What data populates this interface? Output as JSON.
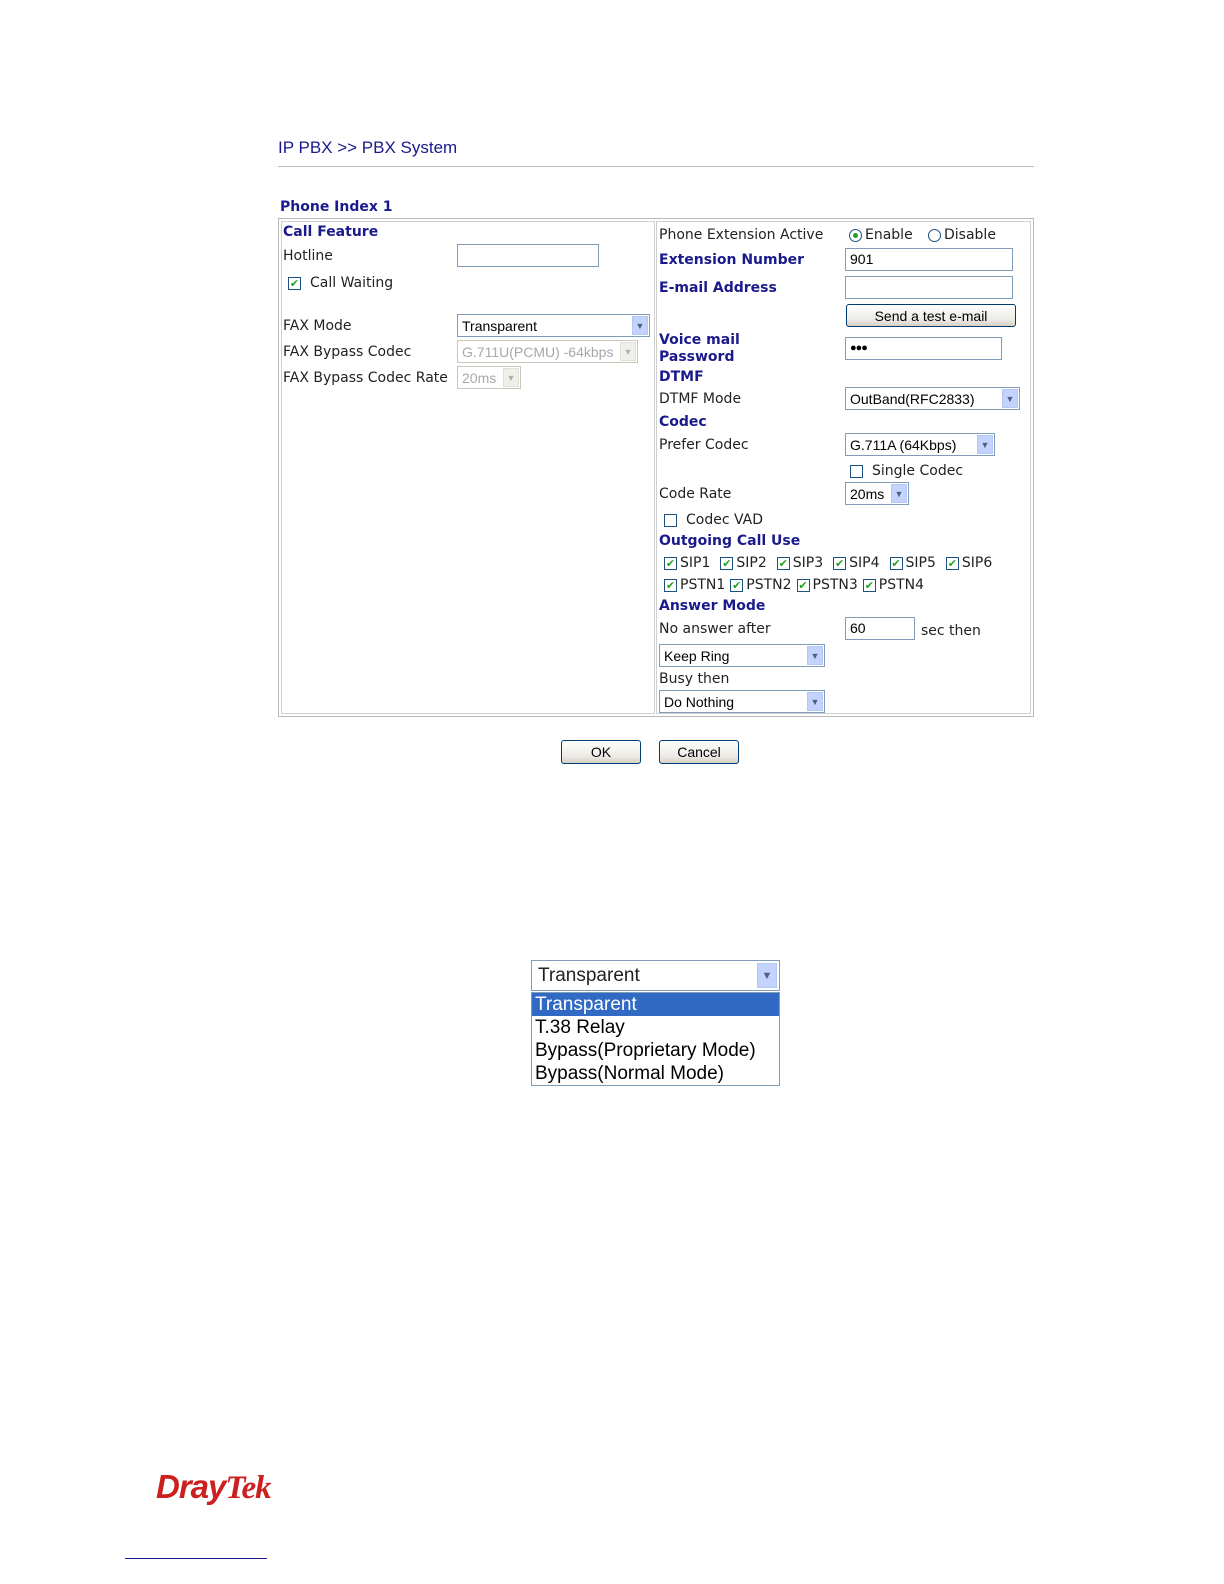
{
  "header": {
    "title": "IP PBX >> PBX System",
    "phone_index": "Phone Index 1"
  },
  "left": {
    "call_feature": "Call Feature",
    "hotline_label": "Hotline",
    "hotline_value": "",
    "call_waiting_label": "Call Waiting",
    "call_waiting_checked": true,
    "fax_mode_label": "FAX Mode",
    "fax_mode_value": "Transparent",
    "fax_bypass_codec_label": "FAX Bypass Codec",
    "fax_bypass_codec_value": "G.711U(PCMU) -64kbps",
    "fax_bypass_rate_label": "FAX Bypass Codec Rate",
    "fax_bypass_rate_value": "20ms"
  },
  "right": {
    "active_label": "Phone Extension Active",
    "enable_label": "Enable",
    "disable_label": "Disable",
    "active_selected": "Enable",
    "ext_number_label": "Extension Number",
    "ext_number_value": "901",
    "email_label": "E-mail Address",
    "email_value": "",
    "send_test_button": "Send a test e-mail",
    "voicemail_label_1": "Voice mail",
    "voicemail_label_2": "Password",
    "voicemail_value": "●●●",
    "dtmf_header": "DTMF",
    "dtmf_mode_label": "DTMF Mode",
    "dtmf_mode_value": "OutBand(RFC2833)",
    "codec_header": "Codec",
    "prefer_codec_label": "Prefer Codec",
    "prefer_codec_value": "G.711A (64Kbps)",
    "single_codec_label": "Single Codec",
    "code_rate_label": "Code Rate",
    "code_rate_value": "20ms",
    "codec_vad_label": "Codec VAD",
    "outgoing_header": "Outgoing Call Use",
    "outgoing_sip": [
      "SIP1",
      "SIP2",
      "SIP3",
      "SIP4",
      "SIP5",
      "SIP6"
    ],
    "outgoing_pstn": [
      "PSTN1",
      "PSTN2",
      "PSTN3",
      "PSTN4"
    ],
    "answer_header": "Answer Mode",
    "no_answer_label": "No answer after",
    "no_answer_value": "60",
    "sec_then": "sec then",
    "no_answer_action": "Keep Ring",
    "busy_label": "Busy then",
    "busy_action": "Do Nothing"
  },
  "buttons": {
    "ok": "OK",
    "cancel": "Cancel"
  },
  "fax_dropdown": {
    "current": "Transparent",
    "options": [
      "Transparent",
      "T.38 Relay",
      "Bypass(Proprietary Mode)",
      "Bypass(Normal Mode)"
    ],
    "highlighted": "Transparent"
  },
  "logo": {
    "part1": "Dray",
    "part2": "Tek"
  },
  "colors": {
    "header_blue": "#1a1a8c",
    "check_green": "#21a121",
    "logo_red": "#cc1f1f",
    "highlight": "#316ac5"
  }
}
